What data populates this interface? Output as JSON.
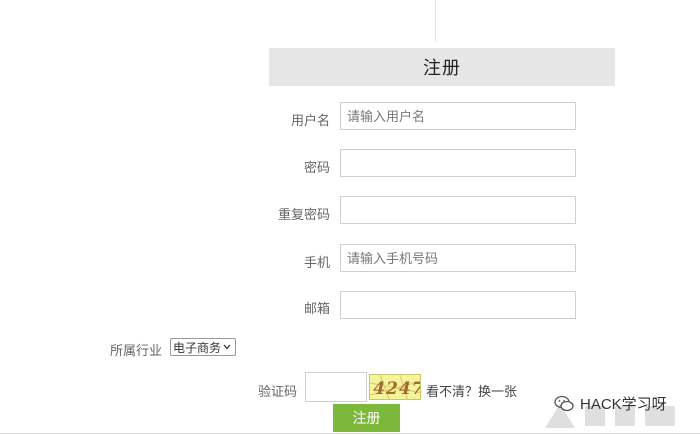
{
  "header": {
    "title": "注册"
  },
  "form": {
    "username": {
      "label": "用户名",
      "placeholder": "请输入用户名"
    },
    "password": {
      "label": "密码",
      "placeholder": ""
    },
    "confirm_password": {
      "label": "重复密码",
      "placeholder": ""
    },
    "phone": {
      "label": "手机",
      "placeholder": "请输入手机号码"
    },
    "email": {
      "label": "邮箱",
      "placeholder": ""
    },
    "industry": {
      "label": "所属行业",
      "selected": "电子商务"
    },
    "captcha": {
      "label": "验证码",
      "image_text": "4247",
      "refresh_text": "看不清？换一张"
    },
    "submit_label": "注册"
  },
  "watermark": {
    "text": "HACK学习呀"
  },
  "colors": {
    "accent": "#7cb83a",
    "header_bg": "#e6e6e6",
    "captcha_bg": "#f4f59a"
  },
  "icons": [
    "chevron-down-icon",
    "wechat-icon"
  ]
}
